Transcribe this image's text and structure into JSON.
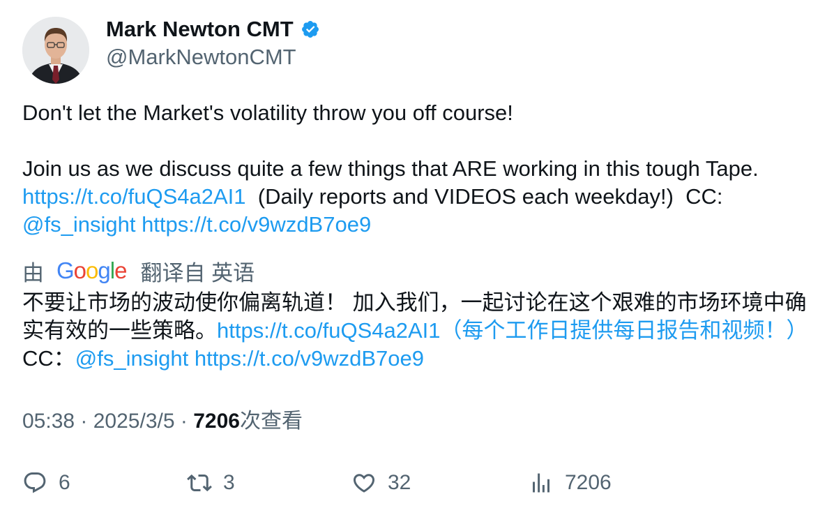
{
  "author": {
    "display_name": "Mark Newton CMT",
    "handle": "@MarkNewtonCMT",
    "verified": true,
    "verified_color": "#1d9bf0"
  },
  "tweet": {
    "line1": "Don't let the Market's volatility throw you off course!",
    "line2": "Join us as we discuss quite a few things that ARE working in this tough Tape.",
    "link1": "https://t.co/fuQS4a2AI1",
    "mid_text": "  (Daily reports and VIDEOS each weekday!)  CC: ",
    "mention": "@fs_insight",
    "link2": "https://t.co/v9wzdB7oe9"
  },
  "translation": {
    "by_label": "由",
    "google_logo": "Google",
    "from_label": "翻译自 英语",
    "text_start": "不要让市场的波动使你偏离轨道！ 加入我们，一起讨论在这个艰难的市场环境中确实有效的一些策略。",
    "link_text": "https://t.co/fuQS4a2AI1（每个工作日提供每日报告和视频！）",
    "cc_text": " CC：",
    "mention": "@fs_insight",
    "link2": "https://t.co/v9wzdB7oe9"
  },
  "meta": {
    "time": "05:38",
    "sep1": " · ",
    "date": "2025/3/5",
    "sep2": " · ",
    "views_count": "7206",
    "views_label": "次查看"
  },
  "actions": {
    "replies": "6",
    "retweets": "3",
    "likes": "32",
    "views": "7206"
  },
  "colors": {
    "text": "#0f1419",
    "secondary": "#536471",
    "link": "#1d9bf0"
  },
  "icons": [
    "verified-badge-icon",
    "reply-icon",
    "retweet-icon",
    "like-icon",
    "views-icon"
  ]
}
